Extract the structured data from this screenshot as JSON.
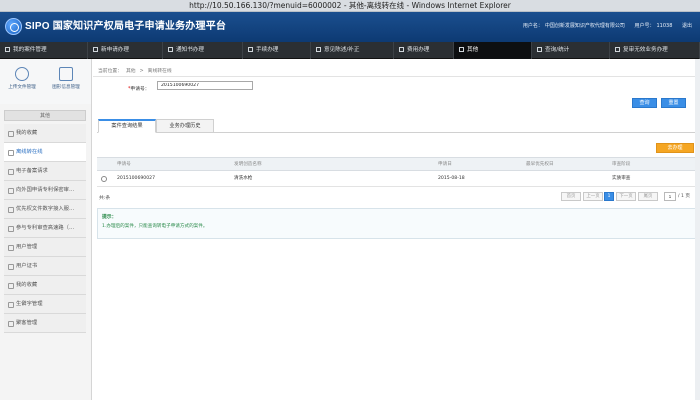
{
  "window": {
    "title": "http://10.50.166.130/?menuid=6000002 - 其他-离线转在线 - Windows Internet Explorer"
  },
  "header": {
    "logo_text": "SIPO",
    "title": "国家知识产权局电子申请业务办理平台",
    "user_label": "用户名：",
    "user_name": "中国创新发展知识产权代理有限公司",
    "user_id_label": "用户号：",
    "user_id": "11038",
    "logout": "退出"
  },
  "nav": {
    "items": [
      {
        "label": "我的案件管理",
        "active": false
      },
      {
        "label": "新申请办理",
        "active": false
      },
      {
        "label": "通知书办理",
        "active": false
      },
      {
        "label": "手续办理",
        "active": false
      },
      {
        "label": "意见陈述/补正",
        "active": false
      },
      {
        "label": "费用办理",
        "active": false
      },
      {
        "label": "其他",
        "active": true
      },
      {
        "label": "查询/统计",
        "active": false
      },
      {
        "label": "复审无效业务办理",
        "active": false
      }
    ]
  },
  "sidebar": {
    "tools": [
      {
        "label": "上传文件管理",
        "icon": "upload-cloud-icon"
      },
      {
        "label": "图形信息管理",
        "icon": "folder-icon"
      }
    ],
    "section_title": "其他",
    "items": [
      {
        "label": "我的收藏",
        "active": false
      },
      {
        "label": "离线转在线",
        "active": true
      },
      {
        "label": "电子备案请求",
        "active": false
      },
      {
        "label": "向外国申请专利保密审…",
        "active": false
      },
      {
        "label": "优先权文件数字接入服…",
        "active": false
      },
      {
        "label": "参与专利审查高速路（…",
        "active": false
      },
      {
        "label": "用户管理",
        "active": false
      },
      {
        "label": "用户证书",
        "active": false
      },
      {
        "label": "我的收藏",
        "active": false
      },
      {
        "label": "生僻字管理",
        "active": false
      },
      {
        "label": "聚客管理",
        "active": false
      }
    ]
  },
  "breadcrumb": [
    "当前位置：",
    "其他",
    ">",
    "离线转在线"
  ],
  "form": {
    "app_no_label": "申请号：",
    "app_no_value": "2015100690027",
    "search_button": "查询",
    "reset_button": "重置"
  },
  "tabs": [
    {
      "label": "案件查询结果",
      "active": true
    },
    {
      "label": "业务办理历史",
      "active": false
    }
  ],
  "actions": {
    "convert_button": "去办理"
  },
  "table": {
    "columns": [
      "申请号",
      "发明创造名称",
      "申请日",
      "最早优先权日",
      "审查阶段"
    ],
    "rows": [
      [
        "2015100690027",
        "清洗水枪",
        "2015-08-18",
        "",
        "实质审查"
      ]
    ]
  },
  "pager": {
    "total_label": "共:条",
    "first": "首页",
    "prev": "上一页",
    "current": "1",
    "next": "下一页",
    "last": "尾页",
    "page_input": "1",
    "of_pages": "/ 1 页"
  },
  "tips": {
    "title": "提示：",
    "text": "1.办理后的案件，只能查询转电子申请方式的案件。"
  }
}
